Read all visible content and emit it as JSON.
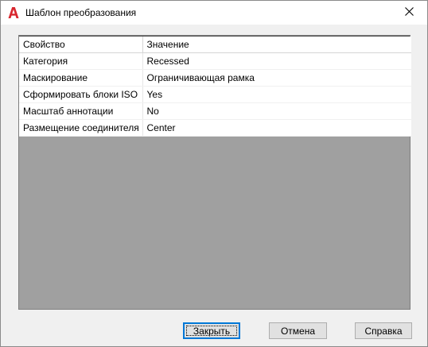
{
  "window": {
    "title": "Шаблон преобразования",
    "app_icon": "autocad-a-icon",
    "close_icon": "close-icon",
    "accent_color": "#d8262e"
  },
  "grid": {
    "columns": [
      "Свойство",
      "Значение"
    ],
    "rows": [
      {
        "property": "Категория",
        "value": "Recessed"
      },
      {
        "property": "Маскирование",
        "value": "Ограничивающая рамка"
      },
      {
        "property": "Сформировать блоки ISO",
        "value": "Yes"
      },
      {
        "property": "Масштаб аннотации",
        "value": "No"
      },
      {
        "property": "Размещение соединителя",
        "value": "Center"
      }
    ]
  },
  "buttons": {
    "close": "Закрыть",
    "cancel": "Отмена",
    "help": "Справка"
  }
}
